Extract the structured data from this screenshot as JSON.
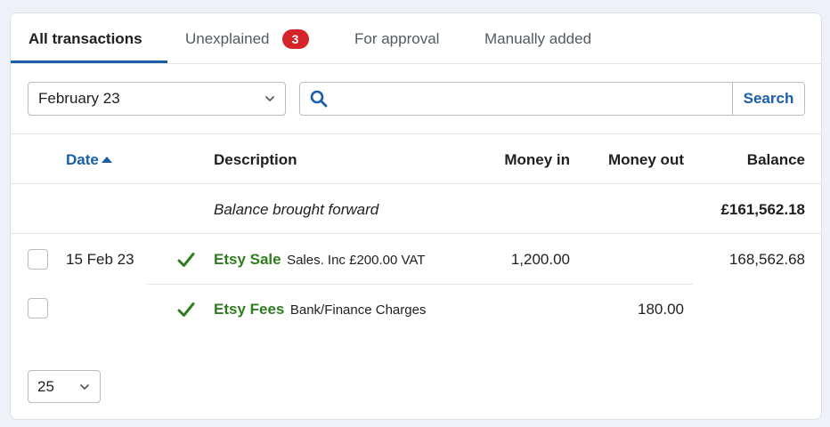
{
  "tabs": [
    {
      "label": "All transactions",
      "active": true
    },
    {
      "label": "Unexplained",
      "badge": "3"
    },
    {
      "label": "For approval"
    },
    {
      "label": "Manually added"
    }
  ],
  "filters": {
    "period": "February 23",
    "search_placeholder": "",
    "search_button": "Search"
  },
  "table": {
    "headers": {
      "date": "Date",
      "description": "Description",
      "money_in": "Money in",
      "money_out": "Money out",
      "balance": "Balance"
    },
    "brought_forward": {
      "label": "Balance brought forward",
      "balance": "£161,562.18"
    },
    "rows": [
      {
        "date": "15 Feb 23",
        "contact": "Etsy Sale",
        "category": "Sales. Inc £200.00 VAT",
        "money_in": "1,200.00",
        "money_out": "",
        "balance": "168,562.68"
      },
      {
        "date": "",
        "contact": "Etsy Fees",
        "category": "Bank/Finance Charges",
        "money_in": "",
        "money_out": "180.00",
        "balance": ""
      }
    ]
  },
  "pagination": {
    "per_page": "25"
  },
  "colors": {
    "accent": "#1a5ea8",
    "badge": "#d6242d",
    "explained": "#2e7d1f"
  }
}
